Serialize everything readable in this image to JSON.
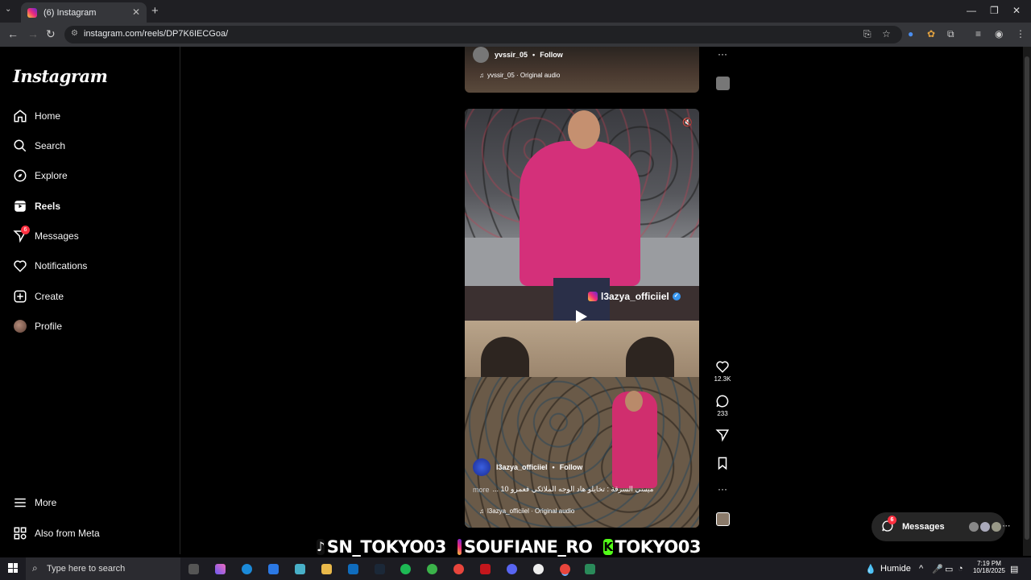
{
  "browser": {
    "tab_title": "(6) Instagram",
    "url": "instagram.com/reels/DP7K6IECGoa/"
  },
  "sidebar": {
    "logo": "Instagram",
    "items": [
      {
        "label": "Home"
      },
      {
        "label": "Search"
      },
      {
        "label": "Explore"
      },
      {
        "label": "Reels"
      },
      {
        "label": "Messages",
        "badge": "6"
      },
      {
        "label": "Notifications"
      },
      {
        "label": "Create"
      },
      {
        "label": "Profile"
      }
    ],
    "bottom": [
      {
        "label": "More"
      },
      {
        "label": "Also from Meta"
      }
    ]
  },
  "prev_reel": {
    "username": "yvssir_05",
    "follow": "Follow",
    "audio": "yvssir_05 · Original audio"
  },
  "main_reel": {
    "watermark_user": "l3azya_officiiel",
    "username": "l3azya_officiiel",
    "follow": "Follow",
    "caption": "ميسي السرقة : تخايلو هاد الوجه الملائكي فعمرو 10 ...",
    "more": "more",
    "audio": "l3azya_officiiel · Original audio",
    "likes": "12.3K",
    "comments": "233"
  },
  "overlay_banner": {
    "tiktok": "SN_TOKYO03",
    "instagram": "SOUFIANE_RO",
    "kick": "TOKYO03"
  },
  "messages_pill": {
    "label": "Messages",
    "badge": "6"
  },
  "taskbar": {
    "search_placeholder": "Type here to search",
    "weather": "Humide",
    "time": "7:19 PM",
    "date": "10/18/2025"
  }
}
